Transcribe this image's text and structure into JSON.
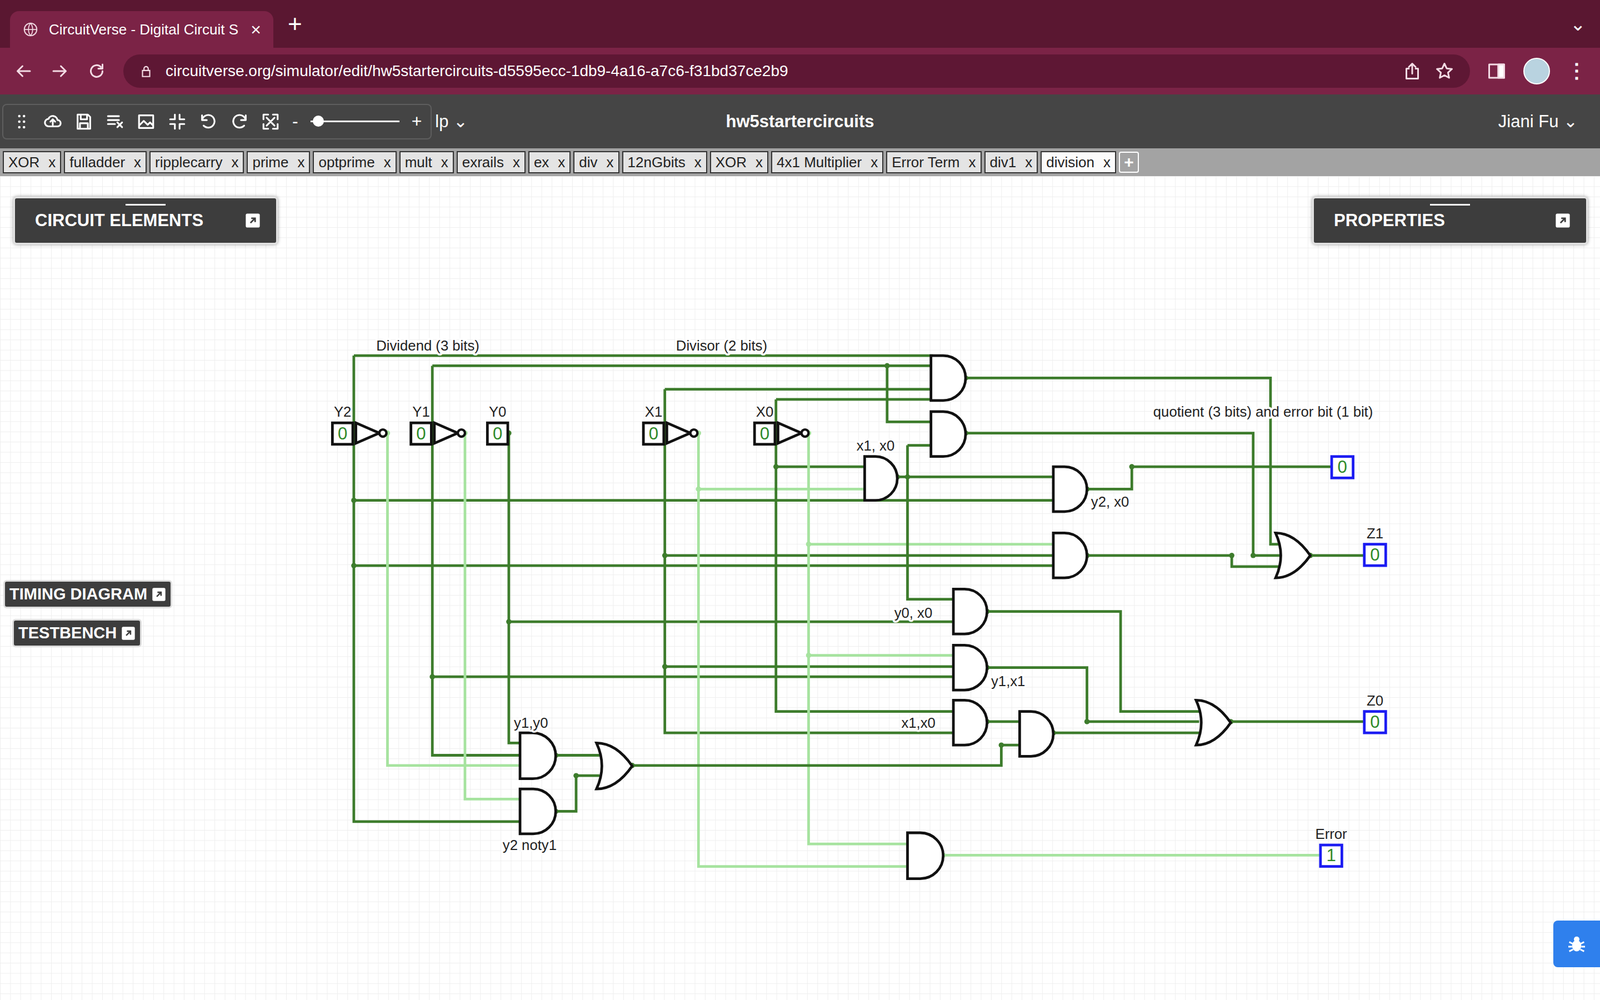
{
  "browser": {
    "tab": {
      "title": "CircuitVerse - Digital Circuit S",
      "close": "×"
    },
    "new_tab": "+",
    "tab_menu": "⌄",
    "url": "circuitverse.org/simulator/edit/hw5startercircuits-d5595ecc-1db9-4a16-a7c6-f31bd37ce2b9",
    "menu": "⋮"
  },
  "toolbar": {
    "zoom_out": "-",
    "zoom_in": "+",
    "zoom_level": 0.05,
    "help": "lp ⌄"
  },
  "project": {
    "title": "hw5startercircuits",
    "user": "Jiani Fu ⌄"
  },
  "circuit_tabs": [
    {
      "label": "XOR",
      "selected": false
    },
    {
      "label": "fulladder",
      "selected": false
    },
    {
      "label": "ripplecarry",
      "selected": false
    },
    {
      "label": "prime",
      "selected": false
    },
    {
      "label": "optprime",
      "selected": false
    },
    {
      "label": "mult",
      "selected": false
    },
    {
      "label": "exrails",
      "selected": false
    },
    {
      "label": "ex",
      "selected": false
    },
    {
      "label": "div",
      "selected": false
    },
    {
      "label": "12nGbits",
      "selected": false
    },
    {
      "label": "XOR",
      "selected": false
    },
    {
      "label": "4x1 Multiplier",
      "selected": false
    },
    {
      "label": "Error Term",
      "selected": false
    },
    {
      "label": "div1",
      "selected": false
    },
    {
      "label": "division",
      "selected": true
    }
  ],
  "tab_close": "x",
  "add_tab": "+",
  "panels": {
    "elements": "CIRCUIT ELEMENTS",
    "properties": "PROPERTIES",
    "timing": "TIMING DIAGRAM",
    "testbench": "TESTBENCH"
  },
  "diagram": {
    "labels": [
      "Dividend (3 bits)",
      "Divisor (2 bits)",
      "quotient (3 bits) and error bit (1 bit)",
      "x1, x0",
      "y2, x0",
      "y0, x0",
      "y1,x1",
      "x1,x0",
      "y1,y0",
      "y2 noty1"
    ],
    "inputs": [
      {
        "label": "Y2",
        "value": "0"
      },
      {
        "label": "Y1",
        "value": "0"
      },
      {
        "label": "Y0",
        "value": "0"
      },
      {
        "label": "X1",
        "value": "0"
      },
      {
        "label": "X0",
        "value": "0"
      }
    ],
    "outputs": [
      {
        "value": "0"
      },
      {
        "label": "Z1",
        "value": "0"
      },
      {
        "label": "Z0",
        "value": "0"
      },
      {
        "label": "Error",
        "value": "1"
      }
    ],
    "wires": [
      {
        "high": false
      },
      {
        "high": true
      },
      {
        "high": false
      },
      {
        "high": true
      },
      {
        "high": false
      },
      {
        "high": false
      },
      {
        "high": true
      },
      {
        "high": false
      },
      {
        "high": true
      },
      {
        "high": false
      },
      {
        "high": false
      },
      {
        "high": false
      },
      {
        "high": false
      },
      {
        "high": false
      },
      {
        "high": false
      },
      {
        "high": false
      },
      {
        "high": false
      },
      {
        "high": false
      },
      {
        "high": false
      },
      {
        "high": false
      },
      {
        "high": false
      },
      {
        "high": false
      },
      {
        "high": false
      },
      {
        "high": true
      }
    ]
  }
}
